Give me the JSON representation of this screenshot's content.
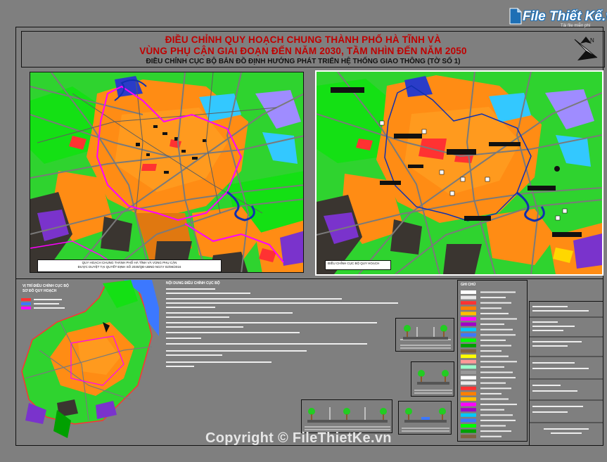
{
  "title": {
    "line1": "ĐIỀU CHỈNH QUY HOẠCH CHUNG THÀNH PHỐ HÀ TĨNH VÀ",
    "line2": "VÙNG PHỤ CẬN GIAI ĐOẠN ĐẾN NĂM 2030, TẦM NHÌN ĐẾN NĂM 2050",
    "line3": "ĐIỀU CHỈNH CỤC BỘ BẢN ĐỒ ĐỊNH HƯỚNG PHÁT TRIỂN HỆ THỐNG GIAO THÔNG  (TỜ SỐ 1)"
  },
  "logo": {
    "name": "File Thiết Kế.vn",
    "tagline": "Tải file miễn phí"
  },
  "map_left": {
    "caption": [
      "QUY HOẠCH CHUNG THÀNH PHỐ HÀ TĨNH VÀ VÙNG PHỤ CẬN",
      "ĐƯỢC DUYỆT TẠI QUYẾT ĐỊNH SỐ 2030/QĐ-UBND NGÀY 02/08/2016"
    ]
  },
  "map_right": {
    "caption": "ĐIỀU CHỈNH CỤC BỘ QUY HOẠCH"
  },
  "mini_map": {
    "title_line1": "VỊ TRÍ ĐIỀU CHỈNH CỤC BỘ",
    "title_line2": "SƠ ĐỒ QUY HOẠCH"
  },
  "notes": {
    "heading": "NỘI DUNG ĐIỀU CHỈNH CỤC BỘ"
  },
  "legend": {
    "title": "GHI CHÚ",
    "swatch_colors": [
      "#ffffff",
      "#e8e8e8",
      "#ff3232",
      "#ff7f00",
      "#ffbf00",
      "#ff00ff",
      "#a000c8",
      "#00c8ff",
      "#3c78ff",
      "#00ff00",
      "#00a000",
      "#806040",
      "#ffff00",
      "#ff9999",
      "#99ffcc",
      "#999999"
    ]
  },
  "colors": {
    "background": "#7f7f7f",
    "title_red": "#c00000",
    "orange": "#ff7f00",
    "green": "#33cc33",
    "lime": "#00ff00",
    "dark": "#3a3530",
    "magenta": "#ff00ff",
    "purple": "#6633cc",
    "river": "#2040c0",
    "lake": "#9080ff"
  },
  "watermark": "Copyright © FileThietKe.vn"
}
